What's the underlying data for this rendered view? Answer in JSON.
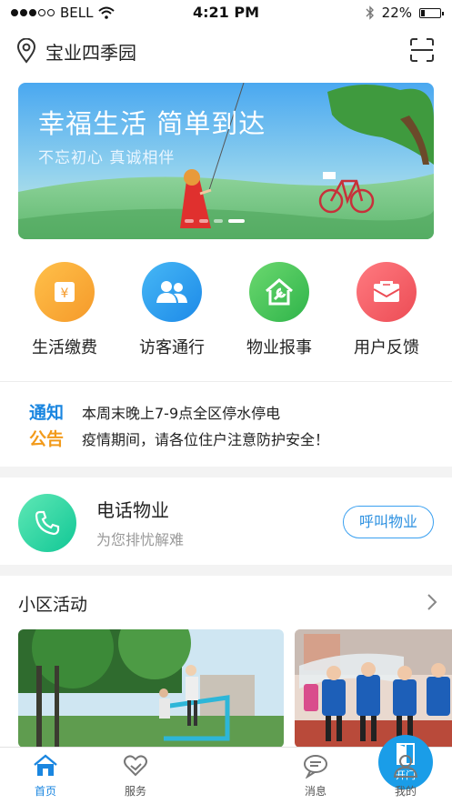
{
  "status_bar": {
    "carrier": "BELL",
    "time": "4:21 PM",
    "battery_pct": "22%",
    "battery_level": 0.22
  },
  "header": {
    "community": "宝业四季园"
  },
  "banner": {
    "title": "幸福生活 简单到达",
    "subtitle": "不忘初心 真诚相伴",
    "slide_count": 4,
    "active_slide": 4
  },
  "services": [
    {
      "label": "生活缴费",
      "icon": "wallet-yuan-icon",
      "color": "#f6a93a"
    },
    {
      "label": "访客通行",
      "icon": "visitors-icon",
      "color": "#2b9bf0"
    },
    {
      "label": "物业报事",
      "icon": "house-repair-icon",
      "color": "#3fc45a"
    },
    {
      "label": "用户反馈",
      "icon": "envelope-icon",
      "color": "#f0575e"
    }
  ],
  "notice": {
    "badge_line1": "通知",
    "badge_line2": "公告",
    "lines": [
      "本周末晚上7-9点全区停水停电",
      "疫情期间，请各位住户注意防护安全！"
    ]
  },
  "phone_service": {
    "title": "电话物业",
    "subtitle": "为您排忧解难",
    "button": "呼叫物业"
  },
  "activities": {
    "title": "小区活动"
  },
  "tab_bar": {
    "tabs": [
      {
        "label": "首页",
        "icon": "home-icon",
        "active": true
      },
      {
        "label": "服务",
        "icon": "heart-hands-icon",
        "active": false
      },
      {
        "label": "开门",
        "icon": "door-icon",
        "active": false
      },
      {
        "label": "消息",
        "icon": "chat-bubble-icon",
        "active": false
      },
      {
        "label": "我的",
        "icon": "user-icon",
        "active": false
      }
    ]
  },
  "colors": {
    "accent": "#1a86e0",
    "notice_blue": "#1a86e0",
    "notice_orange": "#f29a1a",
    "phone_green": "#11c796"
  }
}
